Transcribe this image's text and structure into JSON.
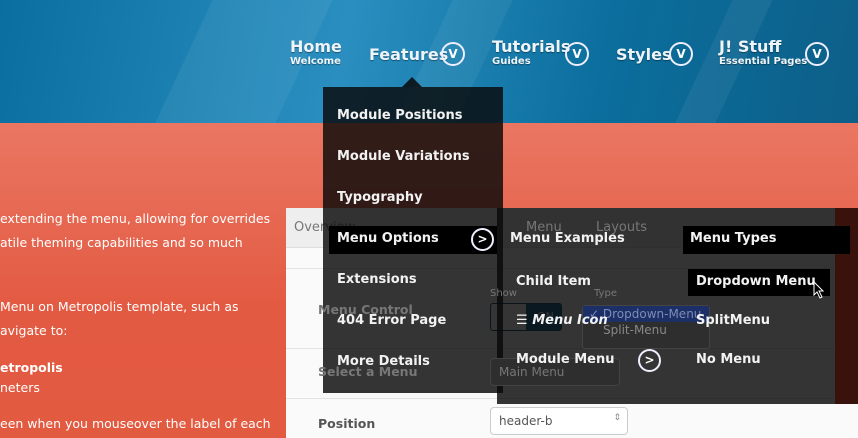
{
  "nav": [
    {
      "title": "Home",
      "sub": "Welcome"
    },
    {
      "title": "Features"
    },
    {
      "title": "Tutorials",
      "sub": "Guides"
    },
    {
      "title": "Styles"
    },
    {
      "title": "J! Stuff",
      "sub": "Essential Pages"
    }
  ],
  "body_text": [
    "extending the menu, allowing for overrides",
    "atile theming capabilities and so much",
    "Menu on Metropolis template, such as",
    "avigate to:",
    "etropolis",
    "neters",
    "een when you mouseover the label of each"
  ],
  "panel": {
    "tabs": [
      "Overview",
      "Menu",
      "Layouts"
    ],
    "labels": [
      "Menu Control",
      "Select a Menu",
      "Position"
    ],
    "show_label": "Show",
    "type_label": "Type",
    "toggle": "ON",
    "type_options": [
      "Dropdown-Menu",
      "Split-Menu"
    ],
    "menu_select": "Main Menu",
    "position_select": "header-b"
  },
  "menu1": [
    "Module Positions",
    "Module Variations",
    "Typography",
    "Menu Options",
    "Extensions",
    "404 Error Page",
    "More Details"
  ],
  "menu2": [
    "Menu Examples",
    "Child Item",
    "Menu Icon",
    "Module Menu"
  ],
  "menu3": [
    "Menu Types",
    "Dropdown Menu",
    "SplitMenu",
    "No Menu"
  ]
}
